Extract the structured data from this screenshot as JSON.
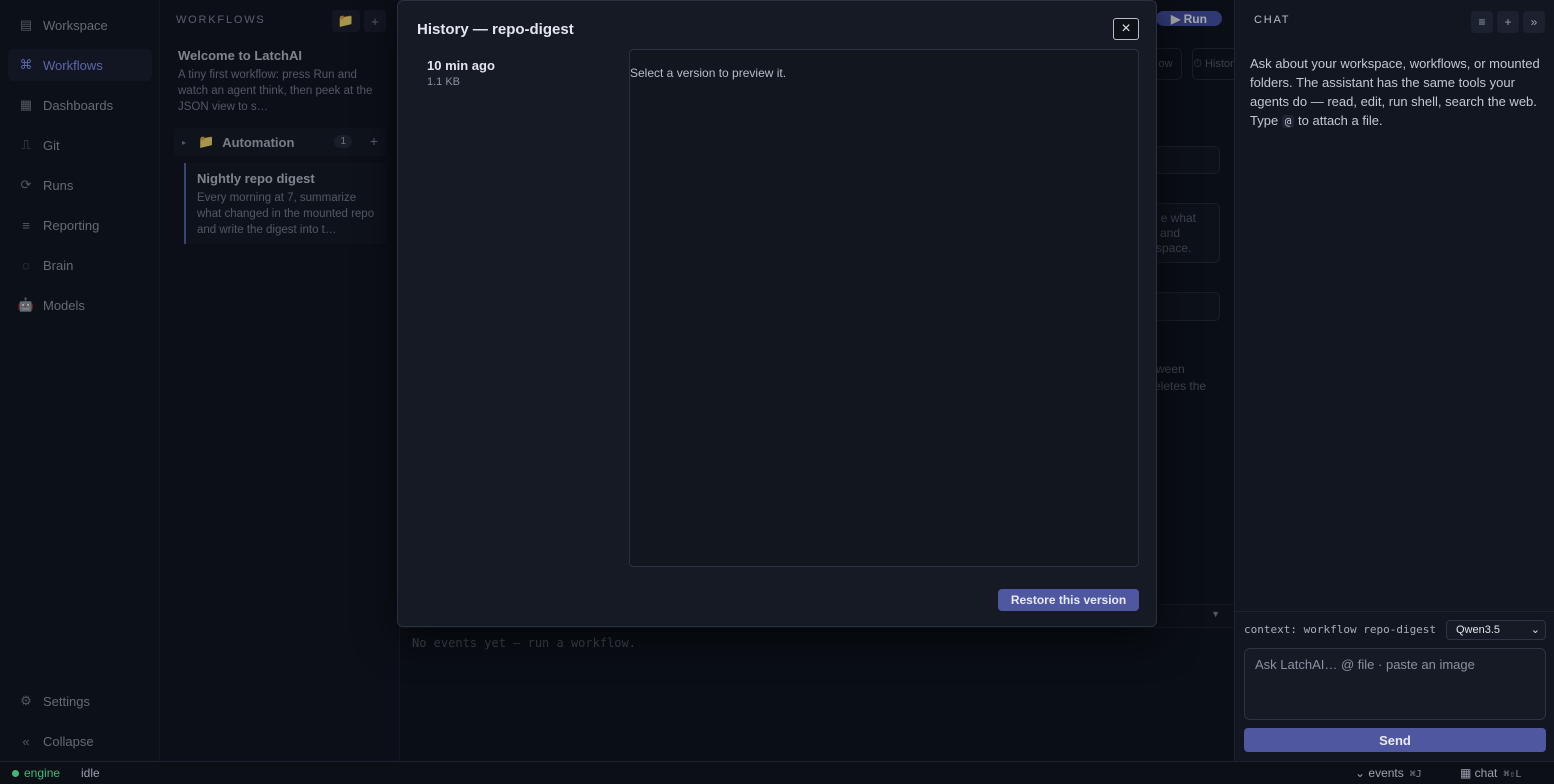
{
  "nav": {
    "items": [
      {
        "label": "Workspace",
        "icon": "grid-icon",
        "glyph": "▤"
      },
      {
        "label": "Workflows",
        "icon": "command-icon",
        "glyph": "⌘"
      },
      {
        "label": "Dashboards",
        "icon": "table-icon",
        "glyph": "▦"
      },
      {
        "label": "Git",
        "icon": "git-icon",
        "glyph": "⎍"
      },
      {
        "label": "Runs",
        "icon": "refresh-icon",
        "glyph": "⟳"
      },
      {
        "label": "Reporting",
        "icon": "list-icon",
        "glyph": "≡"
      },
      {
        "label": "Brain",
        "icon": "brain-icon",
        "glyph": "◌"
      },
      {
        "label": "Models",
        "icon": "robot-icon",
        "glyph": "🤖"
      }
    ],
    "settings": "Settings",
    "collapse": "Collapse"
  },
  "workflows": {
    "header": "WORKFLOWS",
    "welcome": {
      "title": "Welcome to LatchAI",
      "desc": "A tiny first workflow: press Run and watch an agent think, then peek at the JSON view to s…"
    },
    "folder": {
      "label": "Automation",
      "count": "1"
    },
    "item": {
      "title": "Nightly repo digest",
      "desc": "Every morning at 7, summarize what changed in the mounted repo and write the digest into t…"
    }
  },
  "editor": {
    "run_label": "▶ Run",
    "tab_a": "ow",
    "tab_b": "⏱ Histor",
    "frag1": "e what",
    "frag2": "and",
    "frag3": "space.",
    "frag4": "ween",
    "frag5": "eletes the",
    "events_empty": "No events yet — run a workflow."
  },
  "modal": {
    "title": "History — repo-digest",
    "close": "×",
    "versions": [
      {
        "time": "10 min ago",
        "size": "1.1 KB"
      }
    ],
    "preview_hint": "Select a version to preview it.",
    "restore": "Restore this version"
  },
  "chat": {
    "header": "CHAT",
    "intro_before": "Ask about your workspace, workflows, or mounted folders. The assistant has the same tools your agents do — read, edit, run shell, search the web. Type ",
    "intro_at": "@",
    "intro_after": " to attach a file.",
    "context": "context: workflow repo-digest",
    "model": "Qwen3.5",
    "input_placeholder": "Ask LatchAI…  @ file · paste an image",
    "send": "Send"
  },
  "status": {
    "engine": "engine",
    "state": "idle",
    "events": "⌄ events",
    "events_kbd": "⌘J",
    "chat": "▦ chat",
    "chat_kbd": "⌘⇧L"
  }
}
